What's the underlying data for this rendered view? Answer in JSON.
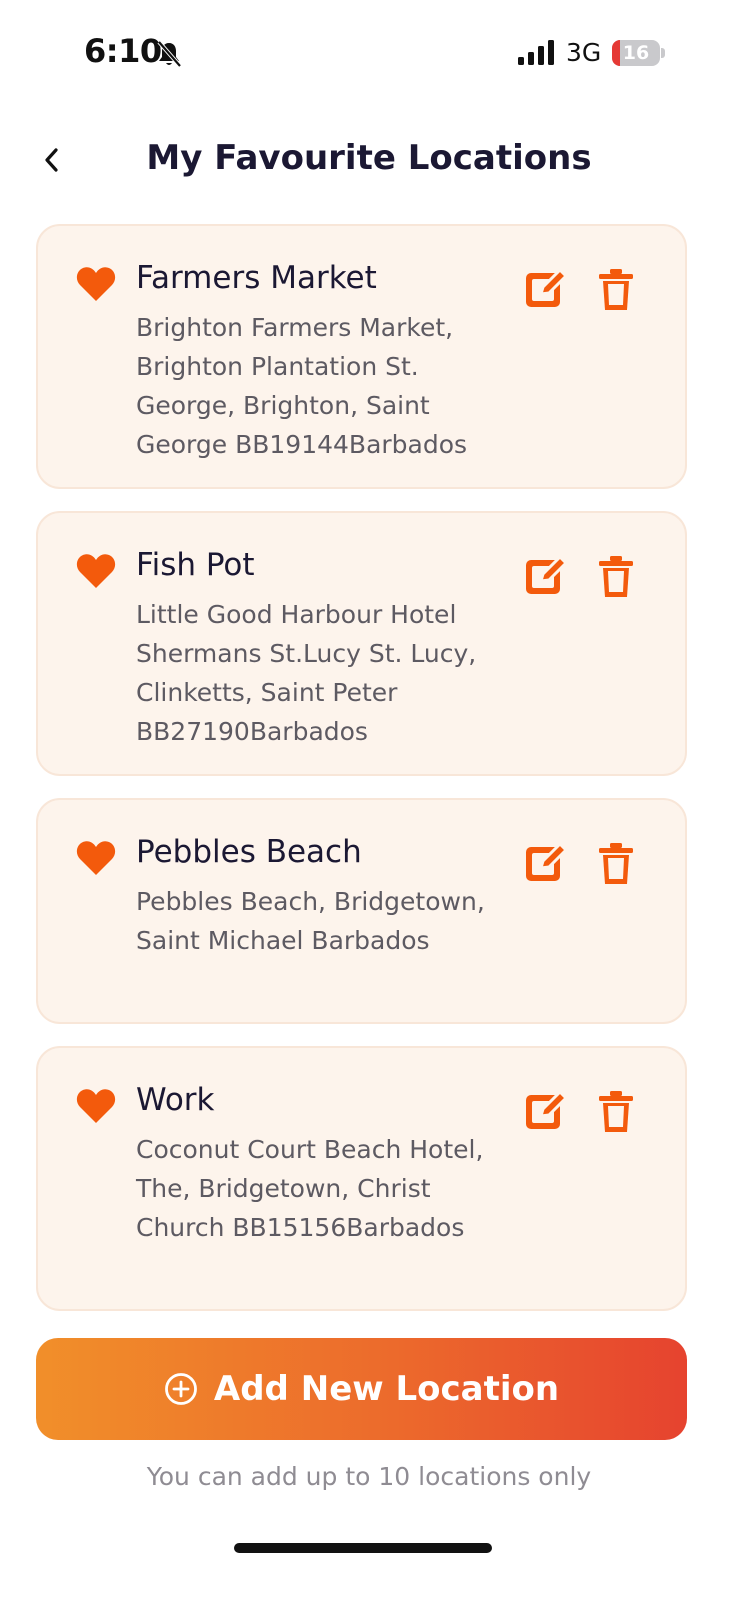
{
  "status_bar": {
    "time": "6:10",
    "network": "3G",
    "battery_level": "16",
    "battery_fraction": 0.16,
    "silent_icon": "bell-slash-icon",
    "signal_icon": "cellular-signal-icon"
  },
  "header": {
    "title": "My Favourite Locations",
    "back_icon": "chevron-left-icon"
  },
  "colors": {
    "accent": "#F35A0C",
    "card_background": "#FDF4EC",
    "gradient_start": "#F18F2A",
    "gradient_end": "#E6432F"
  },
  "locations": [
    {
      "name": "Farmers Market",
      "address": "Brighton Farmers Market, Brighton Plantation St. George, Brighton, Saint George BB19144Barbados"
    },
    {
      "name": "Fish Pot",
      "address": "Little Good Harbour Hotel Shermans St.Lucy St. Lucy, Clinketts, Saint Peter BB27190Barbados"
    },
    {
      "name": "Pebbles Beach",
      "address": "Pebbles Beach, Bridgetown, Saint Michael Barbados"
    },
    {
      "name": "Work",
      "address": "Coconut Court Beach Hotel, The, Bridgetown, Christ Church BB15156Barbados"
    }
  ],
  "add_button": {
    "label": "Add New Location",
    "icon": "plus-circle-icon"
  },
  "footer_note": "You can add up to 10 locations only"
}
